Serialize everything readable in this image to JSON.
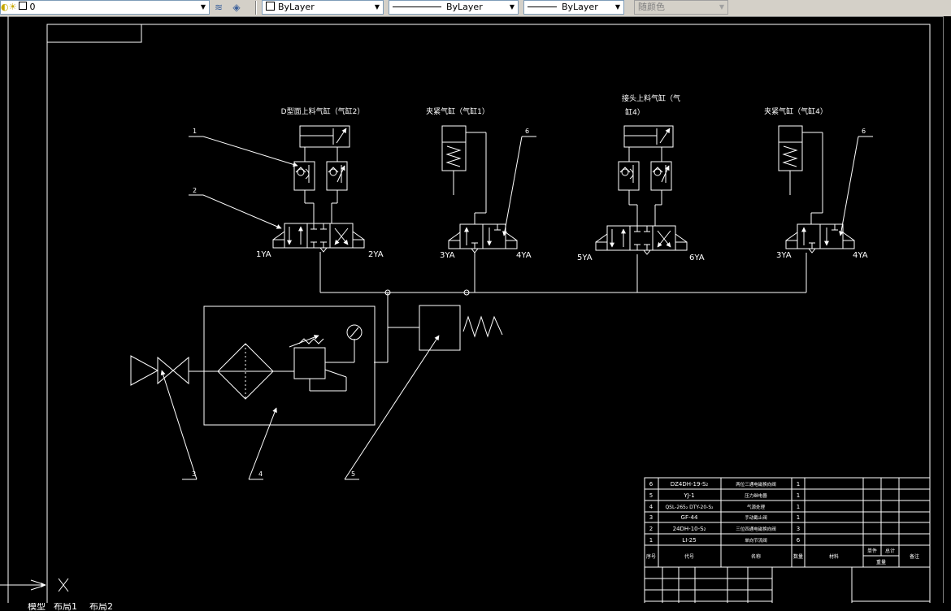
{
  "toolbar": {
    "layer_value": "0",
    "color_value": "ByLayer",
    "linetype_value": "ByLayer",
    "lineweight_value": "ByLayer",
    "plotstyle_value": "随颜色"
  },
  "tabs": [
    "模型",
    "布局1",
    "布局2"
  ],
  "labels": {
    "cyl2": "D型面上料气缸（气缸2）",
    "cyl1": "夹紧气缸（气缸1）",
    "cyl4a_1": "接头上料气缸（气",
    "cyl4a_2": "缸4）",
    "cyl4b": "夹紧气缸（气缸4）",
    "y1": "1YA",
    "y2": "2YA",
    "y3": "3YA",
    "y4": "4YA",
    "y5": "5YA",
    "y6": "6YA",
    "y3b": "3YA",
    "y4b": "4YA",
    "l1": "1",
    "l2": "2",
    "l6a": "6",
    "l6b": "6",
    "l3": "3",
    "l4": "4",
    "l5": "5"
  },
  "bom": {
    "rows": [
      {
        "no": "6",
        "code": "DZ4DH-19-S₂",
        "name": "两位三通电磁换向阀",
        "qty": "1"
      },
      {
        "no": "5",
        "code": "YJ-1",
        "name": "压力继电器",
        "qty": "1"
      },
      {
        "no": "4",
        "code": "QSL-265₂ DTY-20-S₂",
        "name": "气源处理",
        "qty": "1"
      },
      {
        "no": "3",
        "code": "GF-44",
        "name": "手动截止阀",
        "qty": "1"
      },
      {
        "no": "2",
        "code": "24DH-10-S₂",
        "name": "三位四通电磁换向阀",
        "qty": "3"
      },
      {
        "no": "1",
        "code": "LI-25",
        "name": "单向节流阀",
        "qty": "6"
      }
    ],
    "header": {
      "no": "序号",
      "code": "代号",
      "name": "名称",
      "qty": "数量",
      "material": "材料",
      "unit_weight": "单件",
      "total_weight": "总计",
      "weight": "重量",
      "remark": "备注"
    }
  }
}
